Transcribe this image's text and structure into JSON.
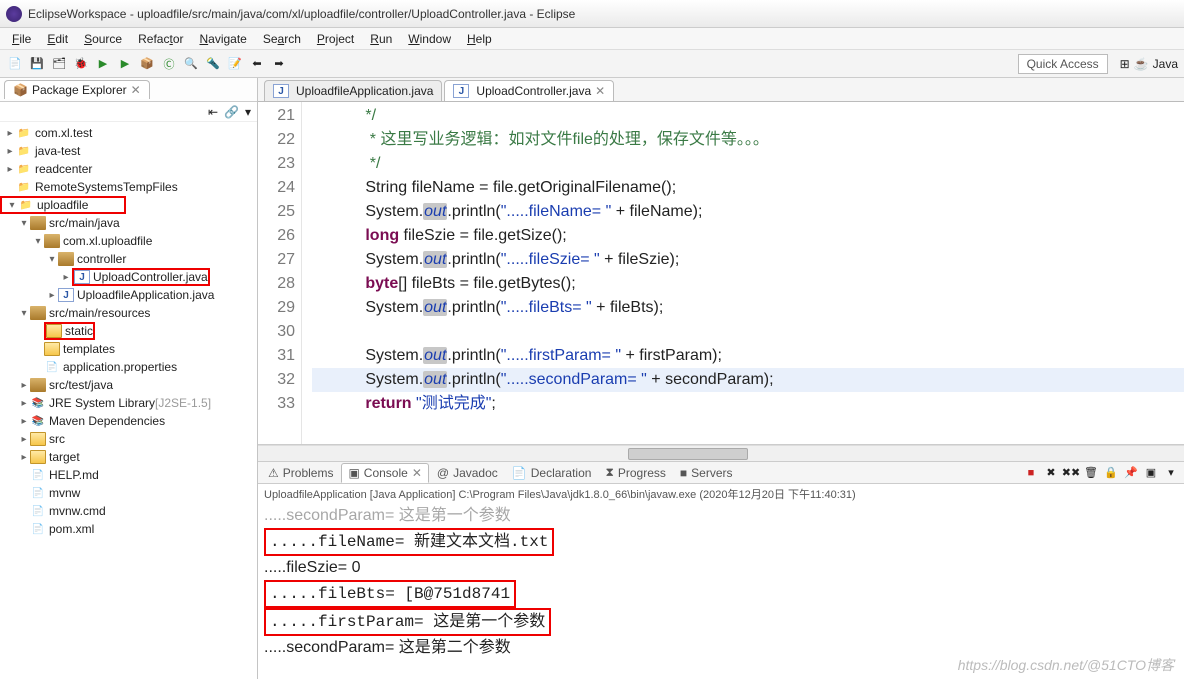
{
  "window": {
    "title": "EclipseWorkspace - uploadfile/src/main/java/com/xl/uploadfile/controller/UploadController.java - Eclipse"
  },
  "menu": {
    "items": [
      "File",
      "Edit",
      "Source",
      "Refactor",
      "Navigate",
      "Search",
      "Project",
      "Run",
      "Window",
      "Help"
    ]
  },
  "toolbar": {
    "quick_access": "Quick Access",
    "perspective": "Java"
  },
  "explorer": {
    "title": "Package Explorer",
    "nodes": {
      "p1": "com.xl.test",
      "p2": "java-test",
      "p3": "readcenter",
      "p4": "RemoteSystemsTempFiles",
      "p5": "uploadfile",
      "p5a": "src/main/java",
      "p5a1": "com.xl.uploadfile",
      "p5a1a": "controller",
      "p5a1a1": "UploadController.java",
      "p5a2": "UploadfileApplication.java",
      "p5b": "src/main/resources",
      "p5b1": "static",
      "p5b2": "templates",
      "p5b3": "application.properties",
      "p5c": "src/test/java",
      "p5d": "JRE System Library",
      "p5d_suffix": " [J2SE-1.5]",
      "p5e": "Maven Dependencies",
      "p5f": "src",
      "p5g": "target",
      "p5h": "HELP.md",
      "p5i": "mvnw",
      "p5j": "mvnw.cmd",
      "p5k": "pom.xml"
    }
  },
  "tabs": {
    "t1": "UploadfileApplication.java",
    "t2": "UploadController.java"
  },
  "code": {
    "lines": {
      "n21": "21",
      "n22": "22",
      "n23": "23",
      "n24": "24",
      "n25": "25",
      "n26": "26",
      "n27": "27",
      "n28": "28",
      "n29": "29",
      "n30": "30",
      "n31": "31",
      "n32": "32",
      "n33": "33"
    },
    "l21": "            */",
    "l22_pre": "             * ",
    "l22_txt": "这里写业务逻辑：如对文件file的处理，保存文件等。。。",
    "l23": "             */",
    "l24_a": "            String fileName = file.getOriginalFilename();",
    "l25_a": "            System.",
    "l25_b": "out",
    "l25_c": ".println(",
    "l25_d": "\".....fileName= \"",
    "l25_e": " + fileName);",
    "l26_a": "            ",
    "l26_kw": "long",
    "l26_b": " fileSzie = file.getSize();",
    "l27_a": "            System.",
    "l27_b": "out",
    "l27_c": ".println(",
    "l27_d": "\".....fileSzie= \"",
    "l27_e": " + fileSzie);",
    "l28_a": "            ",
    "l28_kw": "byte",
    "l28_b": "[] fileBts = file.getBytes();",
    "l29_a": "            System.",
    "l29_b": "out",
    "l29_c": ".println(",
    "l29_d": "\".....fileBts= \"",
    "l29_e": " + fileBts);",
    "l30": "",
    "l31_a": "            System.",
    "l31_b": "out",
    "l31_c": ".println(",
    "l31_d": "\".....firstParam= \"",
    "l31_e": " + firstParam);",
    "l32_a": "            System.",
    "l32_b": "out",
    "l32_c": ".println(",
    "l32_d": "\".....secondParam= \"",
    "l32_e": " + secondParam);",
    "l33_a": "            ",
    "l33_kw": "return",
    "l33_b": " ",
    "l33_str": "\"测试完成\"",
    "l33_c": ";"
  },
  "bottom": {
    "tabs": {
      "problems": "Problems",
      "console": "Console",
      "javadoc": "Javadoc",
      "declaration": "Declaration",
      "progress": "Progress",
      "servers": "Servers"
    },
    "launch_info": "UploadfileApplication [Java Application] C:\\Program Files\\Java\\jdk1.8.0_66\\bin\\javaw.exe (2020年12月20日 下午11:40:31)",
    "rows": {
      "r0": ".....secondParam= 这是第一个参数",
      "r1": ".....fileName= 新建文本文档.txt",
      "r2": ".....fileSzie= 0",
      "r3": ".....fileBts= [B@751d8741",
      "r4": ".....firstParam= 这是第一个参数",
      "r5": ".....secondParam= 这是第二个参数"
    }
  },
  "watermark": "https://blog.csdn.net/@51CTO博客"
}
